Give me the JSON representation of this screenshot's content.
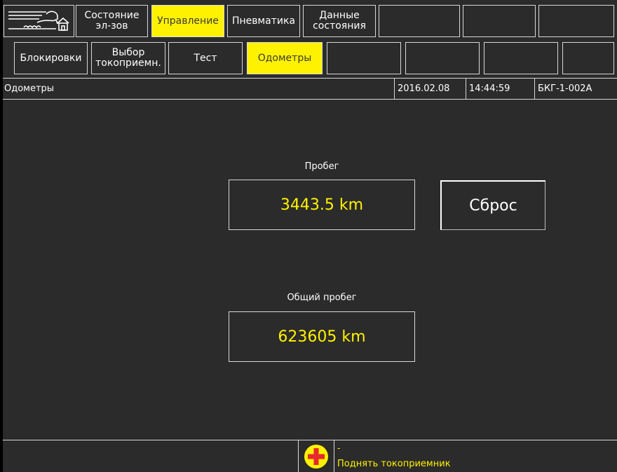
{
  "top_tabs": [
    {
      "label_line1": "Состояние",
      "label_line2": "эл-зов",
      "active": false
    },
    {
      "label_line1": "Управление",
      "label_line2": "",
      "active": true
    },
    {
      "label_line1": "Пневматика",
      "label_line2": "",
      "active": false
    },
    {
      "label_line1": "Данные",
      "label_line2": "состояния",
      "active": false
    }
  ],
  "sub_tabs": [
    {
      "label_line1": "Блокировки",
      "label_line2": "",
      "active": false
    },
    {
      "label_line1": "Выбор",
      "label_line2": "токоприемн.",
      "active": false
    },
    {
      "label_line1": "Тест",
      "label_line2": "",
      "active": false
    },
    {
      "label_line1": "Одометры",
      "label_line2": "",
      "active": true
    }
  ],
  "status": {
    "page_title": "Одометры",
    "date": "2016.02.08",
    "time": "14:44:59",
    "unit_id": "БКГ-1-002А"
  },
  "odometer": {
    "trip_label": "Пробег",
    "trip_value": "3443.5 km",
    "total_label": "Общий пробег",
    "total_value": "623605 km",
    "reset_label": "Сброс"
  },
  "message": {
    "dash": "-",
    "text": "Поднять токоприемник",
    "icon": "red-cross-icon"
  },
  "colors": {
    "background": "#2b2b2b",
    "active_tab": "#fff200",
    "value_text": "#fff200",
    "alarm_icon": "#e8272f"
  }
}
